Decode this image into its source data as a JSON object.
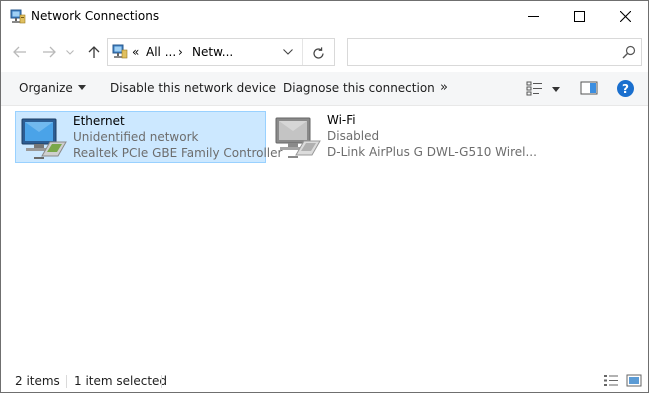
{
  "window": {
    "title": "Network Connections"
  },
  "titlebar_buttons": {
    "minimize": "minimize-icon",
    "maximize": "maximize-icon",
    "close": "close-icon"
  },
  "nav": {
    "back_icon": "back-arrow-icon",
    "forward_icon": "forward-arrow-icon",
    "recent_icon": "chevron-down-icon",
    "up_icon": "up-arrow-icon"
  },
  "address": {
    "overflow": "«",
    "segments": [
      "All ...",
      "Netw..."
    ],
    "separator": "›"
  },
  "search": {
    "placeholder": "",
    "value": ""
  },
  "toolbar": {
    "organize": "Organize",
    "disable": "Disable this network device",
    "diagnose": "Diagnose this connection",
    "more": "»",
    "help": "?"
  },
  "connections": [
    {
      "name": "Ethernet",
      "status": "Unidentified network",
      "device": "Realtek PCIe GBE Family Controller",
      "selected": true
    },
    {
      "name": "Wi-Fi",
      "status": "Disabled",
      "device": "D-Link AirPlus G DWL-G510 Wirel...",
      "selected": false
    }
  ],
  "status": {
    "count": "2 items",
    "selection": "1 item selected"
  },
  "colors": {
    "accent": "#0078d7",
    "selection_bg": "#cce8ff",
    "selection_border": "#99d1ff",
    "help": "#1a6fce"
  }
}
